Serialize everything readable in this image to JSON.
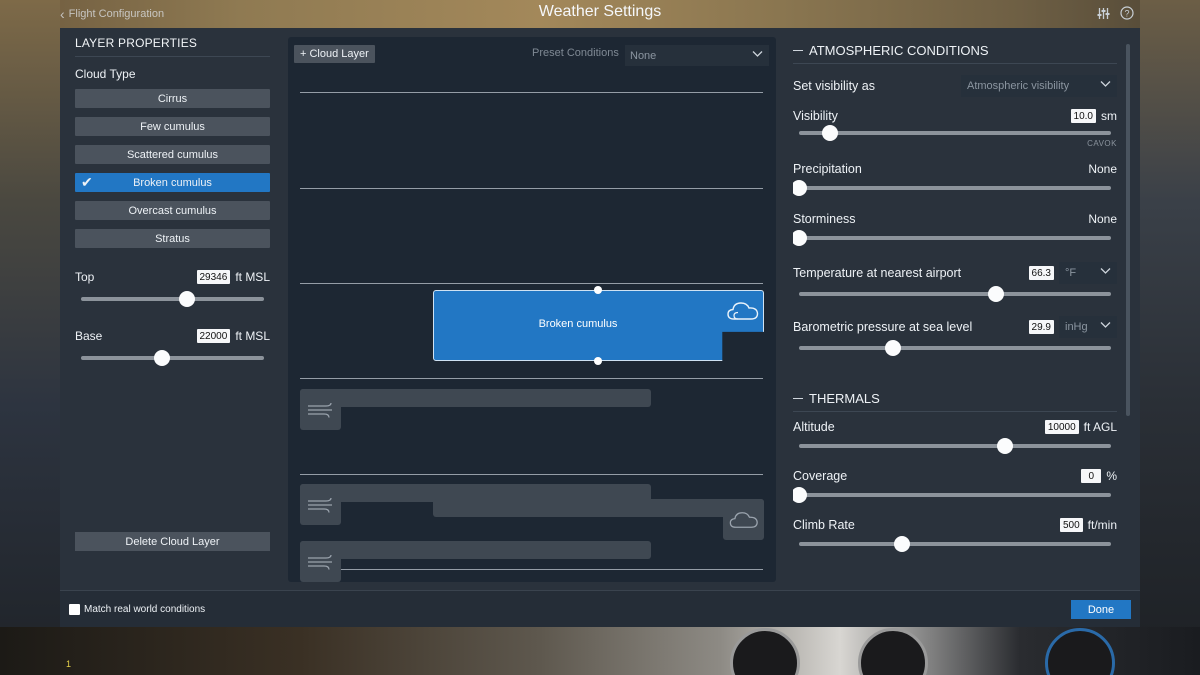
{
  "window": {
    "title": "Weather Settings",
    "back_label": "Flight Configuration"
  },
  "layer_properties": {
    "heading": "LAYER PROPERTIES",
    "cloud_type_label": "Cloud Type",
    "cloud_types": [
      {
        "label": "Cirrus",
        "selected": false
      },
      {
        "label": "Few cumulus",
        "selected": false
      },
      {
        "label": "Scattered cumulus",
        "selected": false
      },
      {
        "label": "Broken cumulus",
        "selected": true
      },
      {
        "label": "Overcast cumulus",
        "selected": false
      },
      {
        "label": "Stratus",
        "selected": false
      }
    ],
    "top": {
      "label": "Top",
      "value": "29346",
      "unit": "ft MSL",
      "slider_fraction": 0.58
    },
    "base": {
      "label": "Base",
      "value": "22000",
      "unit": "ft MSL",
      "slider_fraction": 0.44
    },
    "delete_label": "Delete Cloud Layer"
  },
  "layers_view": {
    "add_label": "+ Cloud Layer",
    "preset_label": "Preset Conditions",
    "preset_value": "None",
    "active_layer_label": "Broken cumulus"
  },
  "atmospheric": {
    "heading": "ATMOSPHERIC CONDITIONS",
    "set_visibility_label": "Set visibility as",
    "set_visibility_value": "Atmospheric visibility",
    "visibility": {
      "label": "Visibility",
      "value": "10.0",
      "unit": "sm",
      "hint": "CAVOK",
      "slider_fraction": 0.1
    },
    "precipitation": {
      "label": "Precipitation",
      "value": "None",
      "slider_fraction": 0.0
    },
    "storminess": {
      "label": "Storminess",
      "value": "None",
      "slider_fraction": 0.0
    },
    "temperature": {
      "label": "Temperature at nearest airport",
      "value": "66.3",
      "unit": "°F",
      "slider_fraction": 0.63
    },
    "pressure": {
      "label": "Barometric pressure at sea level",
      "value": "29.9",
      "unit": "inHg",
      "slider_fraction": 0.3
    }
  },
  "thermals": {
    "heading": "THERMALS",
    "altitude": {
      "label": "Altitude",
      "value": "10000",
      "unit": "ft AGL",
      "slider_fraction": 0.66
    },
    "coverage": {
      "label": "Coverage",
      "value": "0",
      "unit": "%",
      "slider_fraction": 0.0
    },
    "climb_rate": {
      "label": "Climb Rate",
      "value": "500",
      "unit": "ft/min",
      "slider_fraction": 0.33
    }
  },
  "footer": {
    "match_label": "Match real world conditions",
    "match_checked": false,
    "done_label": "Done"
  },
  "background": {
    "corner_text": "1"
  },
  "colors": {
    "accent": "#2277c4",
    "panel": "#2a323c",
    "center_panel": "#1d2733",
    "button": "#4b535d"
  }
}
